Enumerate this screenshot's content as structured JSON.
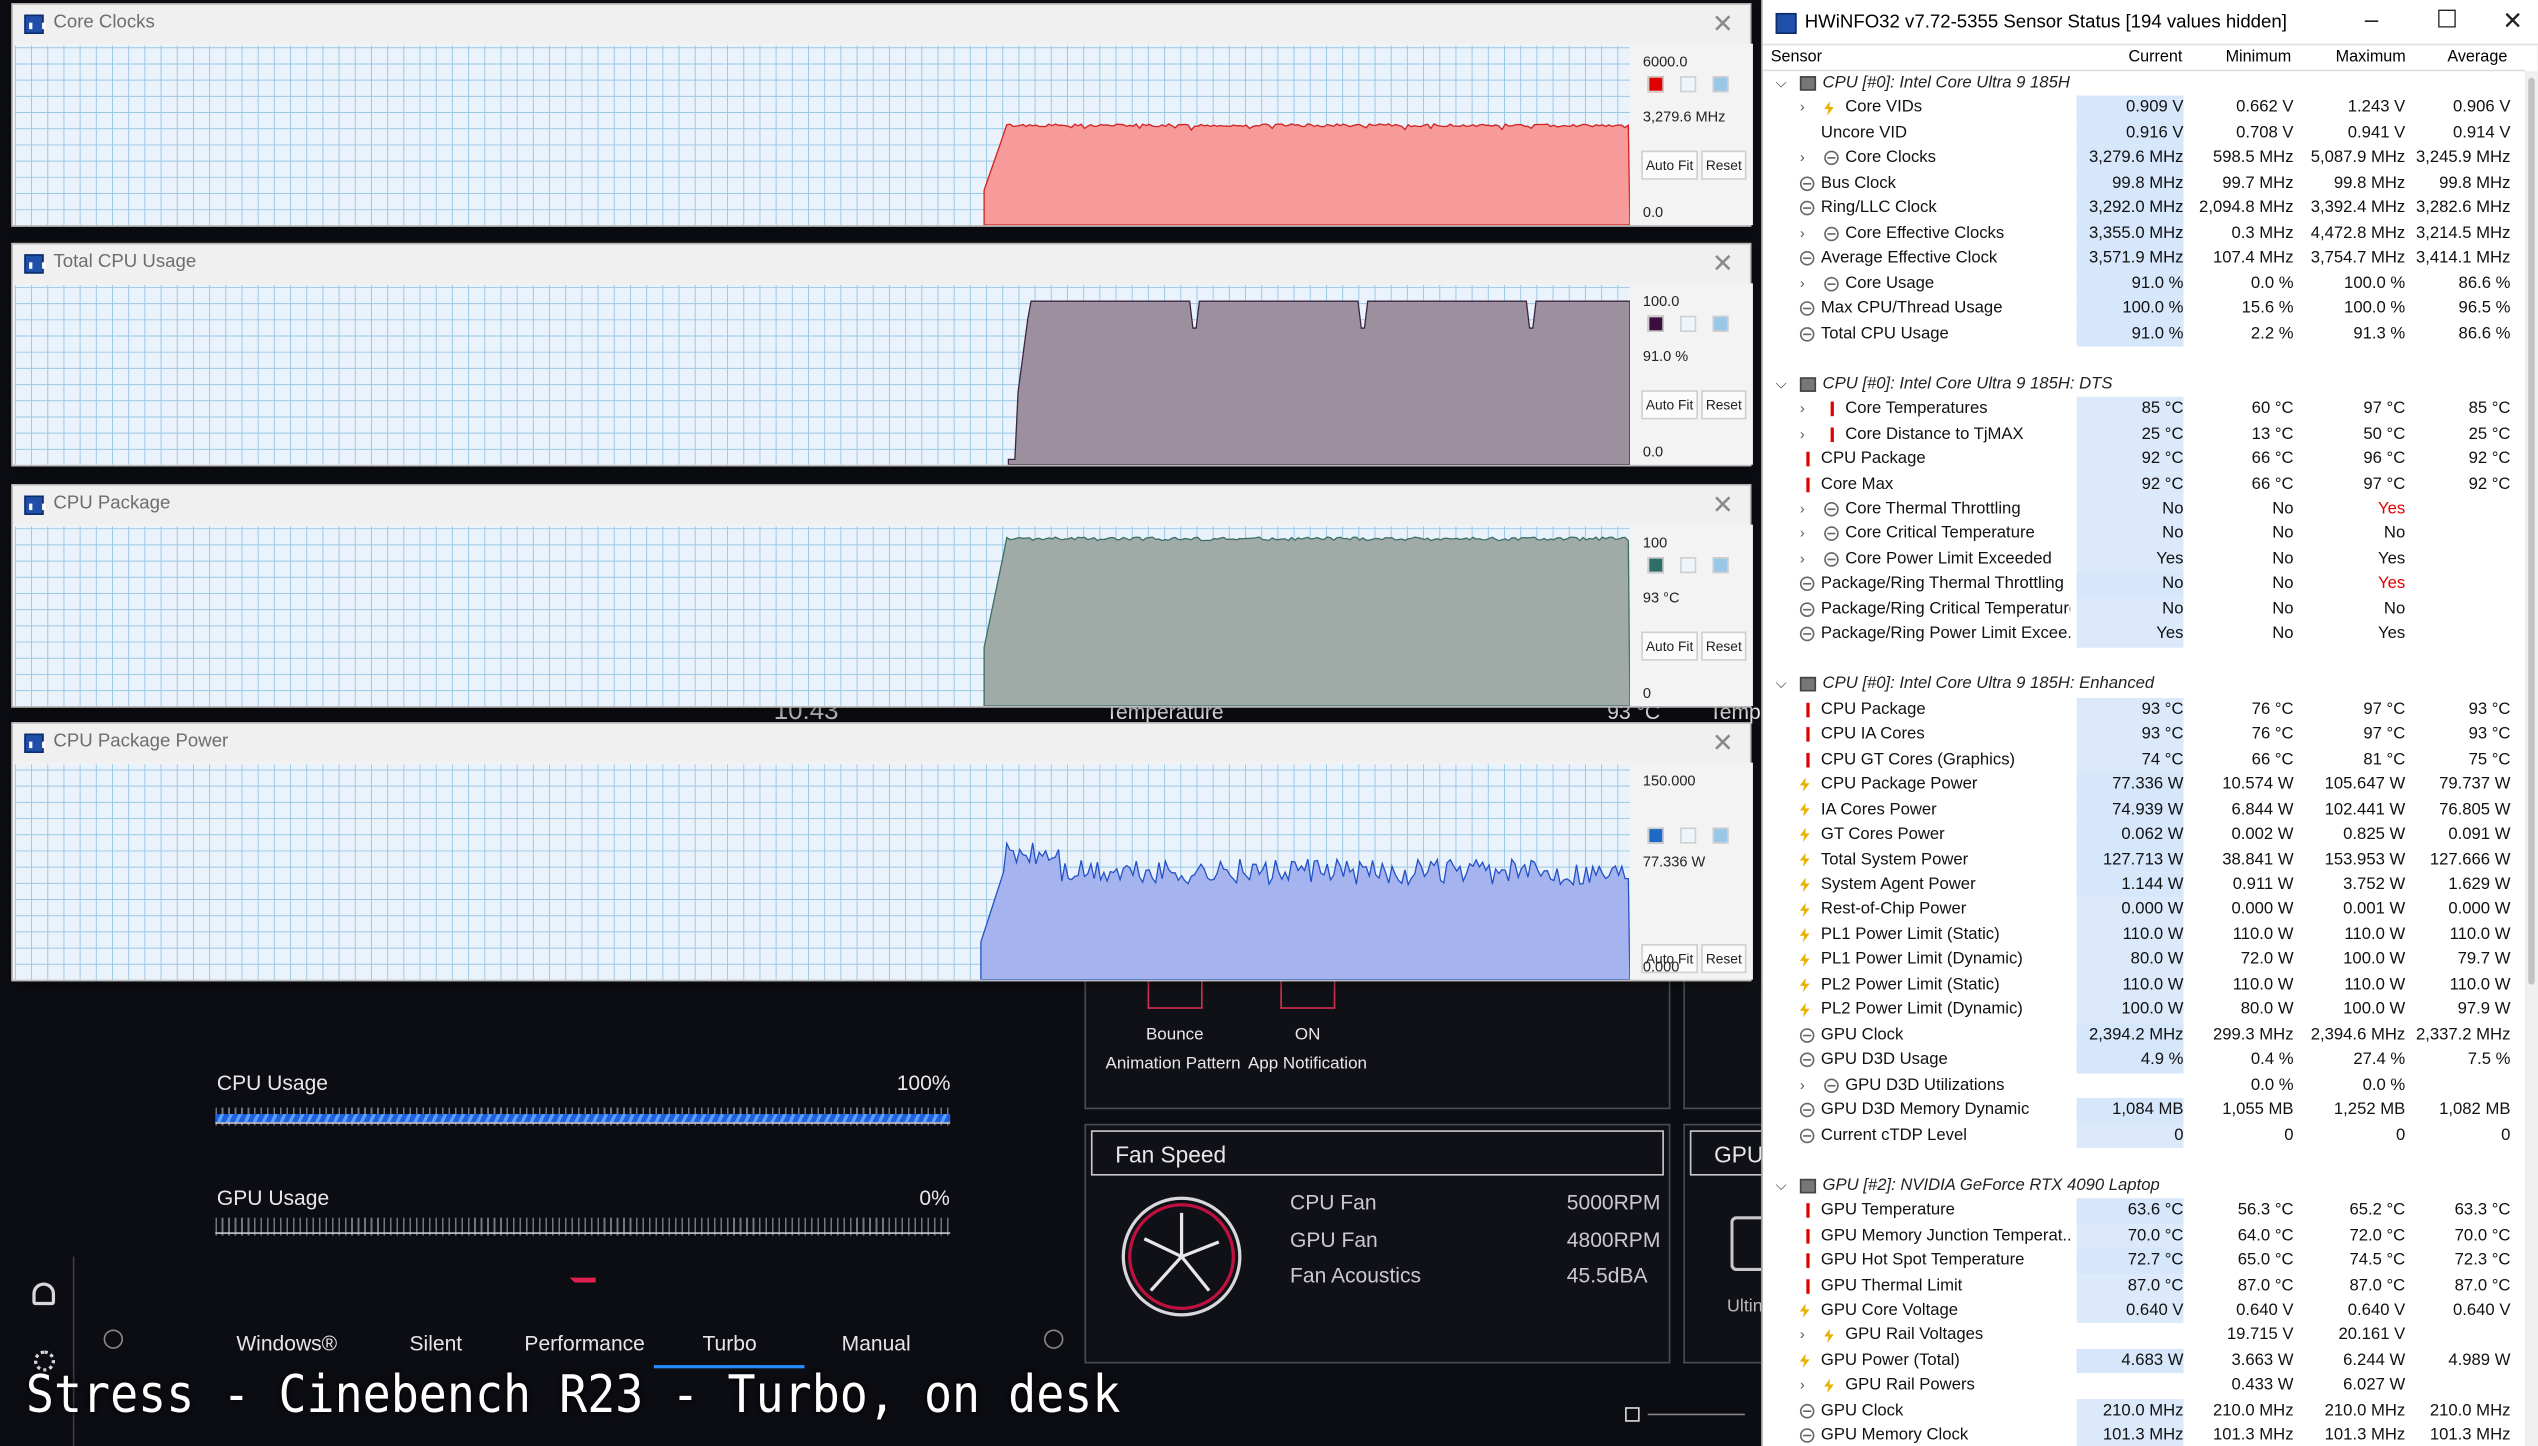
{
  "crate": {
    "cpu_usage_label": "CPU Usage",
    "cpu_usage_value": "100%",
    "cpu_usage_fraction": 1.0,
    "gpu_usage_label": "GPU Usage",
    "gpu_usage_value": "0%",
    "gpu_usage_fraction": 0.0,
    "modes": [
      "Windows®",
      "Silent",
      "Performance",
      "Turbo",
      "Manual"
    ],
    "active_mode": "Turbo",
    "bounce_label": "Bounce",
    "animation_pattern_label": "Animation Pattern",
    "on_label": "ON",
    "app_notification_label": "App Notification",
    "fan_speed_title": "Fan Speed",
    "fans": [
      {
        "label": "CPU Fan",
        "value": "5000RPM"
      },
      {
        "label": "GPU Fan",
        "value": "4800RPM"
      },
      {
        "label": "Fan Acoustics",
        "value": "45.5dBA"
      }
    ],
    "gpu_panel_title": "GPU",
    "ultimate_text": "Ultin",
    "temperature_label": "Temperature",
    "temperature_value": "93 °C",
    "temp_cut": "Tempe",
    "clock_fragment": "10:43"
  },
  "caption": "Stress - Cinebench R23 - Turbo, on desk",
  "graphs": [
    {
      "title": "Core Clocks",
      "max": "6000.0",
      "current": "3,279.6 MHz",
      "min": "0.0",
      "color": "#f79a9a",
      "line": "#d32020",
      "swatch": "#e00000",
      "start": 0.6,
      "level": 0.555,
      "ripple": 0.008,
      "dip": 0.08
    },
    {
      "title": "Total CPU Usage",
      "max": "100.0",
      "current": "91.0 %",
      "min": "0.0",
      "color": "#9c909f",
      "line": "#3c2440",
      "swatch": "#3a0f3e",
      "start": 0.615,
      "level": 0.91,
      "ripple": 0.0,
      "dip": 0.15
    },
    {
      "title": "CPU Package",
      "max": "100",
      "current": "93 °C",
      "min": "0",
      "color": "#a0aaa7",
      "line": "#3c6e66",
      "swatch": "#2e6e68",
      "start": 0.6,
      "level": 0.93,
      "ripple": 0.01,
      "dip": 0.1
    },
    {
      "title": "CPU Package Power",
      "max": "150.000",
      "current": "77.336 W",
      "min": "0.000",
      "color": "#a5b4ee",
      "line": "#2250c8",
      "swatch": "#1e6ac8",
      "start": 0.598,
      "level": 0.5,
      "ripple": 0.06,
      "dip": 0.5
    }
  ],
  "graph_buttons": {
    "auto_fit": "Auto Fit",
    "reset": "Reset"
  },
  "hwinfo": {
    "title": "HWiNFO32 v7.72-5355 Sensor Status [194 values hidden]",
    "columns": [
      "Sensor",
      "Current",
      "Minimum",
      "Maximum",
      "Average"
    ],
    "rows": [
      {
        "t": "g",
        "name": "CPU [#0]: Intel Core Ultra 9 185H"
      },
      {
        "t": "s",
        "ic": "volt",
        "ex": 1,
        "name": "Core VIDs",
        "v": [
          "0.909 V",
          "0.662 V",
          "1.243 V",
          "0.906 V"
        ],
        "hl": 1
      },
      {
        "t": "s",
        "ic": "none",
        "name": "Uncore VID",
        "v": [
          "0.916 V",
          "0.708 V",
          "0.941 V",
          "0.914 V"
        ],
        "hl": 1
      },
      {
        "t": "s",
        "ic": "clk",
        "ex": 1,
        "name": "Core Clocks",
        "v": [
          "3,279.6 MHz",
          "598.5 MHz",
          "5,087.9 MHz",
          "3,245.9 MHz"
        ],
        "hl": 1
      },
      {
        "t": "s",
        "ic": "clk",
        "name": "Bus Clock",
        "v": [
          "99.8 MHz",
          "99.7 MHz",
          "99.8 MHz",
          "99.8 MHz"
        ],
        "hl": 1
      },
      {
        "t": "s",
        "ic": "clk",
        "name": "Ring/LLC Clock",
        "v": [
          "3,292.0 MHz",
          "2,094.8 MHz",
          "3,392.4 MHz",
          "3,282.6 MHz"
        ],
        "hl": 1
      },
      {
        "t": "s",
        "ic": "clk",
        "ex": 1,
        "name": "Core Effective Clocks",
        "v": [
          "3,355.0 MHz",
          "0.3 MHz",
          "4,472.8 MHz",
          "3,214.5 MHz"
        ],
        "hl": 1
      },
      {
        "t": "s",
        "ic": "clk",
        "name": "Average Effective Clock",
        "v": [
          "3,571.9 MHz",
          "107.4 MHz",
          "3,754.7 MHz",
          "3,414.1 MHz"
        ],
        "hl": 1
      },
      {
        "t": "s",
        "ic": "clk",
        "ex": 1,
        "name": "Core Usage",
        "v": [
          "91.0 %",
          "0.0 %",
          "100.0 %",
          "86.6 %"
        ],
        "hl": 1
      },
      {
        "t": "s",
        "ic": "clk",
        "name": "Max CPU/Thread Usage",
        "v": [
          "100.0 %",
          "15.6 %",
          "100.0 %",
          "96.5 %"
        ],
        "hl": 1
      },
      {
        "t": "s",
        "ic": "clk",
        "name": "Total CPU Usage",
        "v": [
          "91.0 %",
          "2.2 %",
          "91.3 %",
          "86.6 %"
        ],
        "hl": 1
      },
      {
        "t": "b"
      },
      {
        "t": "g",
        "name": "CPU [#0]: Intel Core Ultra 9 185H: DTS"
      },
      {
        "t": "s",
        "ic": "temp",
        "ex": 1,
        "name": "Core Temperatures",
        "v": [
          "85 °C",
          "60 °C",
          "97 °C",
          "85 °C"
        ]
      },
      {
        "t": "s",
        "ic": "temp",
        "ex": 1,
        "name": "Core Distance to TjMAX",
        "v": [
          "25 °C",
          "13 °C",
          "50 °C",
          "25 °C"
        ]
      },
      {
        "t": "s",
        "ic": "temp",
        "name": "CPU Package",
        "v": [
          "92 °C",
          "66 °C",
          "96 °C",
          "92 °C"
        ]
      },
      {
        "t": "s",
        "ic": "temp",
        "name": "Core Max",
        "v": [
          "92 °C",
          "66 °C",
          "97 °C",
          "92 °C"
        ]
      },
      {
        "t": "s",
        "ic": "clk",
        "ex": 1,
        "name": "Core Thermal Throttling",
        "v": [
          "No",
          "No",
          "Yes",
          ""
        ],
        "red": 2
      },
      {
        "t": "s",
        "ic": "clk",
        "ex": 1,
        "name": "Core Critical Temperature",
        "v": [
          "No",
          "No",
          "No",
          ""
        ]
      },
      {
        "t": "s",
        "ic": "clk",
        "ex": 1,
        "name": "Core Power Limit Exceeded",
        "v": [
          "Yes",
          "No",
          "Yes",
          ""
        ]
      },
      {
        "t": "s",
        "ic": "clk",
        "name": "Package/Ring Thermal Throttling",
        "v": [
          "No",
          "No",
          "Yes",
          ""
        ],
        "red": 2,
        "hl": 1
      },
      {
        "t": "s",
        "ic": "clk",
        "name": "Package/Ring Critical Temperature",
        "v": [
          "No",
          "No",
          "No",
          ""
        ]
      },
      {
        "t": "s",
        "ic": "clk",
        "name": "Package/Ring Power Limit Excee...",
        "v": [
          "Yes",
          "No",
          "Yes",
          ""
        ]
      },
      {
        "t": "b"
      },
      {
        "t": "g",
        "name": "CPU [#0]: Intel Core Ultra 9 185H: Enhanced"
      },
      {
        "t": "s",
        "ic": "temp",
        "name": "CPU Package",
        "v": [
          "93 °C",
          "76 °C",
          "97 °C",
          "93 °C"
        ]
      },
      {
        "t": "s",
        "ic": "temp",
        "name": "CPU IA Cores",
        "v": [
          "93 °C",
          "76 °C",
          "97 °C",
          "93 °C"
        ]
      },
      {
        "t": "s",
        "ic": "temp",
        "name": "CPU GT Cores (Graphics)",
        "v": [
          "74 °C",
          "66 °C",
          "81 °C",
          "75 °C"
        ]
      },
      {
        "t": "s",
        "ic": "volt",
        "name": "CPU Package Power",
        "v": [
          "77.336 W",
          "10.574 W",
          "105.647 W",
          "79.737 W"
        ],
        "hl": 1
      },
      {
        "t": "s",
        "ic": "volt",
        "name": "IA Cores Power",
        "v": [
          "74.939 W",
          "6.844 W",
          "102.441 W",
          "76.805 W"
        ],
        "hl": 1
      },
      {
        "t": "s",
        "ic": "volt",
        "name": "GT Cores Power",
        "v": [
          "0.062 W",
          "0.002 W",
          "0.825 W",
          "0.091 W"
        ],
        "hl": 1
      },
      {
        "t": "s",
        "ic": "volt",
        "name": "Total System Power",
        "v": [
          "127.713 W",
          "38.841 W",
          "153.953 W",
          "127.666 W"
        ],
        "hl": 1
      },
      {
        "t": "s",
        "ic": "volt",
        "name": "System Agent Power",
        "v": [
          "1.144 W",
          "0.911 W",
          "3.752 W",
          "1.629 W"
        ],
        "hl": 1
      },
      {
        "t": "s",
        "ic": "volt",
        "name": "Rest-of-Chip Power",
        "v": [
          "0.000 W",
          "0.000 W",
          "0.001 W",
          "0.000 W"
        ]
      },
      {
        "t": "s",
        "ic": "volt",
        "name": "PL1 Power Limit (Static)",
        "v": [
          "110.0 W",
          "110.0 W",
          "110.0 W",
          "110.0 W"
        ]
      },
      {
        "t": "s",
        "ic": "volt",
        "name": "PL1 Power Limit (Dynamic)",
        "v": [
          "80.0 W",
          "72.0 W",
          "100.0 W",
          "79.7 W"
        ]
      },
      {
        "t": "s",
        "ic": "volt",
        "name": "PL2 Power Limit (Static)",
        "v": [
          "110.0 W",
          "110.0 W",
          "110.0 W",
          "110.0 W"
        ]
      },
      {
        "t": "s",
        "ic": "volt",
        "name": "PL2 Power Limit (Dynamic)",
        "v": [
          "100.0 W",
          "80.0 W",
          "100.0 W",
          "97.9 W"
        ]
      },
      {
        "t": "s",
        "ic": "clk",
        "name": "GPU Clock",
        "v": [
          "2,394.2 MHz",
          "299.3 MHz",
          "2,394.6 MHz",
          "2,337.2 MHz"
        ],
        "hl": 1
      },
      {
        "t": "s",
        "ic": "clk",
        "name": "GPU D3D Usage",
        "v": [
          "4.9 %",
          "0.4 %",
          "27.4 %",
          "7.5 %"
        ],
        "hl": 1
      },
      {
        "t": "s",
        "ic": "clk",
        "ex": 1,
        "name": "GPU D3D Utilizations",
        "v": [
          "",
          "0.0 %",
          "0.0 %",
          ""
        ]
      },
      {
        "t": "s",
        "ic": "clk",
        "name": "GPU D3D Memory Dynamic",
        "v": [
          "1,084 MB",
          "1,055 MB",
          "1,252 MB",
          "1,082 MB"
        ],
        "hl": 1
      },
      {
        "t": "s",
        "ic": "clk",
        "name": "Current cTDP Level",
        "v": [
          "0",
          "0",
          "0",
          "0"
        ]
      },
      {
        "t": "b"
      },
      {
        "t": "g",
        "name": "GPU [#2]: NVIDIA GeForce RTX 4090 Laptop"
      },
      {
        "t": "s",
        "ic": "temp",
        "name": "GPU Temperature",
        "v": [
          "63.6 °C",
          "56.3 °C",
          "65.2 °C",
          "63.3 °C"
        ],
        "hl": 1
      },
      {
        "t": "s",
        "ic": "temp",
        "name": "GPU Memory Junction Temperat...",
        "v": [
          "70.0 °C",
          "64.0 °C",
          "72.0 °C",
          "70.0 °C"
        ]
      },
      {
        "t": "s",
        "ic": "temp",
        "name": "GPU Hot Spot Temperature",
        "v": [
          "72.7 °C",
          "65.0 °C",
          "74.5 °C",
          "72.3 °C"
        ],
        "hl": 1
      },
      {
        "t": "s",
        "ic": "temp",
        "name": "GPU Thermal Limit",
        "v": [
          "87.0 °C",
          "87.0 °C",
          "87.0 °C",
          "87.0 °C"
        ]
      },
      {
        "t": "s",
        "ic": "volt",
        "name": "GPU Core Voltage",
        "v": [
          "0.640 V",
          "0.640 V",
          "0.640 V",
          "0.640 V"
        ]
      },
      {
        "t": "s",
        "ic": "volt",
        "ex": 1,
        "name": "GPU Rail Voltages",
        "v": [
          "",
          "19.715 V",
          "20.161 V",
          ""
        ]
      },
      {
        "t": "s",
        "ic": "volt",
        "name": "GPU Power (Total)",
        "v": [
          "4.683 W",
          "3.663 W",
          "6.244 W",
          "4.989 W"
        ],
        "hl": 1
      },
      {
        "t": "s",
        "ic": "volt",
        "ex": 1,
        "name": "GPU Rail Powers",
        "v": [
          "",
          "0.433 W",
          "6.027 W",
          ""
        ]
      },
      {
        "t": "s",
        "ic": "clk",
        "name": "GPU Clock",
        "v": [
          "210.0 MHz",
          "210.0 MHz",
          "210.0 MHz",
          "210.0 MHz"
        ]
      },
      {
        "t": "s",
        "ic": "clk",
        "name": "GPU Memory Clock",
        "v": [
          "101.3 MHz",
          "101.3 MHz",
          "101.3 MHz",
          "101.3 MHz"
        ]
      }
    ]
  }
}
